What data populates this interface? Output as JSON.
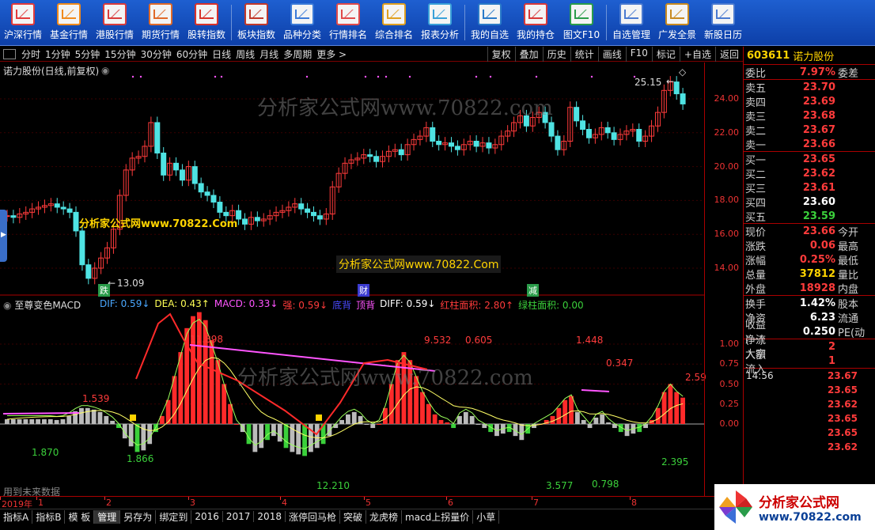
{
  "toolbar": {
    "items": [
      {
        "label": "沪深行情",
        "icon": "market-chart-icon",
        "color": "#e23b3b"
      },
      {
        "label": "基金行情",
        "icon": "fund-icon",
        "color": "#f08a1c"
      },
      {
        "label": "港股行情",
        "icon": "hk-stock-icon",
        "color": "#d93c3c"
      },
      {
        "label": "期货行情",
        "icon": "futures-icon",
        "color": "#e06a2a"
      },
      {
        "label": "股转指数",
        "icon": "index-icon",
        "color": "#d8322a"
      },
      {
        "label": "板块指数",
        "icon": "sector-icon",
        "color": "#c0392b"
      },
      {
        "label": "品种分类",
        "icon": "category-icon",
        "color": "#3b7ad8"
      },
      {
        "label": "行情排名",
        "icon": "ranking-icon",
        "color": "#e04a4a"
      },
      {
        "label": "综合排名",
        "icon": "overall-rank-icon",
        "color": "#e0a020"
      },
      {
        "label": "报表分析",
        "icon": "report-icon",
        "color": "#3aa0d8"
      },
      {
        "label": "我的自选",
        "icon": "watchlist-icon",
        "color": "#2a7ac8"
      },
      {
        "label": "我的持仓",
        "icon": "holdings-icon",
        "color": "#d83a3a"
      },
      {
        "label": "图文F10",
        "icon": "f10-icon",
        "color": "#2a9c4a"
      },
      {
        "label": "自选管理",
        "icon": "manage-icon",
        "color": "#4a7ad0"
      },
      {
        "label": "广发全景",
        "icon": "panorama-icon",
        "color": "#c88a20"
      },
      {
        "label": "新股日历",
        "icon": "calendar-icon",
        "color": "#4a7ad0"
      }
    ]
  },
  "period_bar": {
    "periods": [
      "分时",
      "1分钟",
      "5分钟",
      "15分钟",
      "30分钟",
      "60分钟",
      "日线",
      "周线",
      "月线",
      "多周期",
      "更多 >"
    ],
    "tools": [
      "复权",
      "叠加",
      "历史",
      "统计",
      "画线",
      "F10",
      "标记",
      "+自选",
      "返回"
    ]
  },
  "chart": {
    "title": "诺力股份(日线,前复权)",
    "price_labels": [
      "24.00",
      "22.00",
      "20.00",
      "18.00",
      "16.00",
      "14.00"
    ],
    "price_values": [
      24,
      22,
      20,
      18,
      16,
      14
    ],
    "max_label": "25.15",
    "min_label": "13.09",
    "markers": [
      {
        "text": "跌",
        "color": "#ffffff",
        "bg": "#2a9c4a"
      },
      {
        "text": "财",
        "color": "#ffffff",
        "bg": "#3b3bd0"
      },
      {
        "text": "减",
        "color": "#ffffff",
        "bg": "#2a9c4a"
      }
    ],
    "watermark": "分析家公式网www.70822.com",
    "ad_text": "分析家公式网www.70822.Com"
  },
  "macd_panel": {
    "name": "至尊变色MACD",
    "legend": [
      {
        "text": "DIF: 0.59↓",
        "color": "#4aa8ff"
      },
      {
        "text": "DEA: 0.43↑",
        "color": "#ffff55"
      },
      {
        "text": "MACD: 0.33↓",
        "color": "#ff55ff"
      },
      {
        "text": "强: 0.59↓",
        "color": "#ff3b3b"
      },
      {
        "text": "底背",
        "color": "#4a4aff"
      },
      {
        "text": "顶背",
        "color": "#ff55ff"
      },
      {
        "text": "DIFF: 0.59↓",
        "color": "#ffffff"
      },
      {
        "text": "红柱面积: 2.80↑",
        "color": "#ff3b3b"
      },
      {
        "text": "绿柱面积: 0.00",
        "color": "#3bd03b"
      }
    ],
    "y_labels": [
      "1.00",
      "0.75",
      "0.50",
      "0.25",
      "0.00"
    ],
    "y_values": [
      1.0,
      0.75,
      0.5,
      0.25,
      0.0
    ],
    "annotations": [
      {
        "text": "1.539",
        "color": "#ff3b3b"
      },
      {
        "text": "1.870",
        "color": "#3bd03b"
      },
      {
        "text": "1.866",
        "color": "#3bd03b"
      },
      {
        "text": "11.898",
        "color": "#ff3b3b"
      },
      {
        "text": "12.210",
        "color": "#3bd03b"
      },
      {
        "text": "9.532",
        "color": "#ff3b3b"
      },
      {
        "text": "0.605",
        "color": "#ff3b3b"
      },
      {
        "text": "1.448",
        "color": "#ff3b3b"
      },
      {
        "text": "0.347",
        "color": "#ff3b3b"
      },
      {
        "text": "3.577",
        "color": "#3bd03b"
      },
      {
        "text": "0.798",
        "color": "#3bd03b"
      },
      {
        "text": "2.395",
        "color": "#3bd03b"
      },
      {
        "text": "2.59",
        "color": "#ff3b3b"
      }
    ],
    "future_note": "用到未来数据"
  },
  "quote": {
    "code": "603611",
    "name": "诺力股份",
    "weibi": {
      "label": "委比",
      "value": "7.97%",
      "label2": "委差"
    },
    "sells": [
      {
        "label": "卖五",
        "price": "23.70"
      },
      {
        "label": "卖四",
        "price": "23.69"
      },
      {
        "label": "卖三",
        "price": "23.68"
      },
      {
        "label": "卖二",
        "price": "23.67"
      },
      {
        "label": "卖一",
        "price": "23.66"
      }
    ],
    "buys": [
      {
        "label": "买一",
        "price": "23.65",
        "color": "#ff3b3b"
      },
      {
        "label": "买二",
        "price": "23.62",
        "color": "#ff3b3b"
      },
      {
        "label": "买三",
        "price": "23.61",
        "color": "#ff3b3b"
      },
      {
        "label": "买四",
        "price": "23.60",
        "color": "#ffffff"
      },
      {
        "label": "买五",
        "price": "23.59",
        "color": "#3bd03b"
      }
    ],
    "stats1": [
      {
        "label": "现价",
        "value": "23.66",
        "color": "#ff3b3b",
        "label2": "今开"
      },
      {
        "label": "涨跌",
        "value": "0.06",
        "color": "#ff3b3b",
        "label2": "最高"
      },
      {
        "label": "涨幅",
        "value": "0.25%",
        "color": "#ff3b3b",
        "label2": "最低"
      },
      {
        "label": "总量",
        "value": "37812",
        "color": "#ffd400",
        "label2": "量比"
      },
      {
        "label": "外盘",
        "value": "18928",
        "color": "#ff3b3b",
        "label2": "内盘"
      }
    ],
    "stats2": [
      {
        "label": "换手",
        "value": "1.42%",
        "color": "#ffffff",
        "label2": "股本"
      },
      {
        "label": "净资",
        "value": "6.23",
        "color": "#ffffff",
        "label2": "流通"
      },
      {
        "label": "收益(一)",
        "value": "0.250",
        "color": "#ffffff",
        "label2": "PE(动"
      }
    ],
    "flows": [
      {
        "label": "净流入额",
        "value": "2"
      },
      {
        "label": "大宗流入",
        "value": "1"
      }
    ],
    "ticks": [
      {
        "time": "14:56",
        "price": "23.67"
      },
      {
        "time": "",
        "price": "23.65"
      },
      {
        "time": "",
        "price": "23.62"
      },
      {
        "time": "",
        "price": "23.65"
      },
      {
        "time": "",
        "price": "23.65"
      },
      {
        "time": "",
        "price": "23.62"
      }
    ]
  },
  "date_bar": {
    "labels": [
      "2019年",
      "1",
      "2",
      "3",
      "4",
      "5",
      "6",
      "7",
      "8"
    ]
  },
  "tabs": [
    "指标A",
    "指标B",
    "模 板",
    "管理",
    "另存为",
    "绑定到",
    "2016",
    "2017",
    "2018",
    "涨停回马枪",
    "突破",
    "龙虎榜",
    "macd上拐量价",
    "小草"
  ],
  "active_tab": "管理",
  "brand": {
    "line1": "分析家公式网",
    "line2": "www.70822.com"
  }
}
